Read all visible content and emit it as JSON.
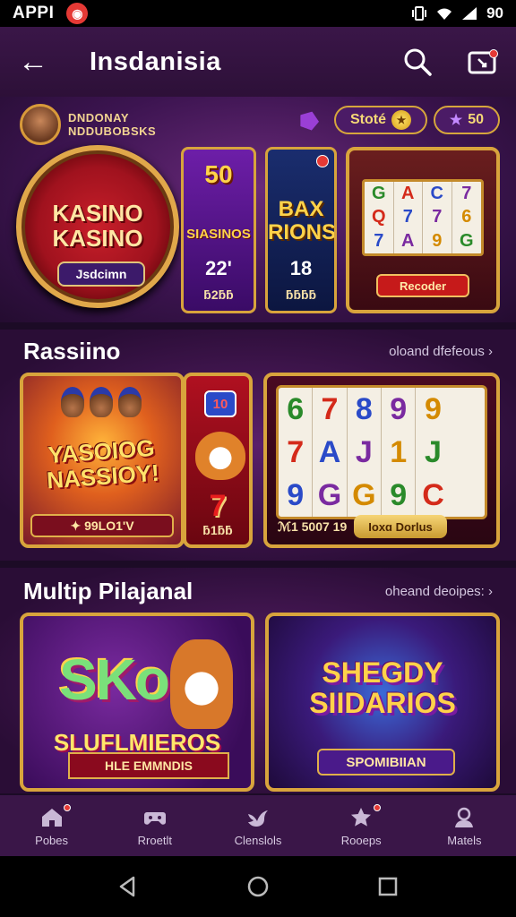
{
  "status_bar": {
    "app_label": "APPI",
    "time": "90"
  },
  "app_bar": {
    "title": "Insdanisia"
  },
  "hero": {
    "username_line1": "DNDONAY",
    "username_line2": "NDDUBOBSKS",
    "slots_chip": "Stoté",
    "stars_chip": "50",
    "wheel_title_line1": "KASINO",
    "wheel_title_line2": "KASINO",
    "wheel_button": "Jsdcimn",
    "card1_top": "50",
    "card1_name": "SIASINOS",
    "card1_value": "22'",
    "card1_pill": "ƃ2ƃƃ",
    "card2_name_line1": "BAX",
    "card2_name_line2": "RIONS",
    "card2_value": "18",
    "card2_pill": "ƃƃƃƃ",
    "machine_button": "Recoder",
    "machine_reels": [
      [
        "G",
        "Q",
        "7"
      ],
      [
        "A",
        "7",
        "A"
      ],
      [
        "C",
        "7",
        "9"
      ],
      [
        "7",
        "6",
        "G"
      ]
    ]
  },
  "section1": {
    "title": "Rassiino",
    "see_all": "oloand dfefeous ›",
    "tile1_logo_line1": "YASOIOG",
    "tile1_logo_line2": "NASSIOY!",
    "tile1_bar": "✦ 99LO1'V",
    "tile2_badge": "10",
    "tile2_seven": "7",
    "tile2_pill": "ƃ1ƃƃ",
    "tile3_reels": [
      [
        "6",
        "7",
        "9"
      ],
      [
        "7",
        "A",
        "G"
      ],
      [
        "8",
        "J",
        "G"
      ],
      [
        "9",
        "1",
        "9"
      ],
      [
        "9",
        "J",
        "C"
      ],
      [
        "",
        "",
        ""
      ]
    ],
    "tile3_amount": "ℳ1 5007 19",
    "tile3_button": "Ioxɑ Dorlus"
  },
  "section2": {
    "title": "Multip Pilajanal",
    "see_all": "oheand deoipes: ›",
    "tile4_big": "SKo",
    "tile4_sub": "SLUFLMIEROS",
    "tile4_ribbon": "HLE EMMNDIS",
    "tile5_logo_line1": "SHEGDY",
    "tile5_logo_line2": "SIIDARIOS",
    "tile5_sub": "SPOMIBIIAN"
  },
  "bottom_nav": {
    "items": [
      {
        "label": "Pobes",
        "icon": "home-icon",
        "badge": true
      },
      {
        "label": "Rroetlt",
        "icon": "gamepad-icon",
        "badge": false
      },
      {
        "label": "Clenslols",
        "icon": "bird-icon",
        "badge": false
      },
      {
        "label": "Rooeps",
        "icon": "star-icon",
        "badge": true
      },
      {
        "label": "Matels",
        "icon": "user-icon",
        "badge": false
      }
    ]
  },
  "colors": {
    "background": "#1c0b26",
    "app_bar": "#3a1648",
    "gold": "#d8a43c",
    "badge": "#e53935"
  }
}
